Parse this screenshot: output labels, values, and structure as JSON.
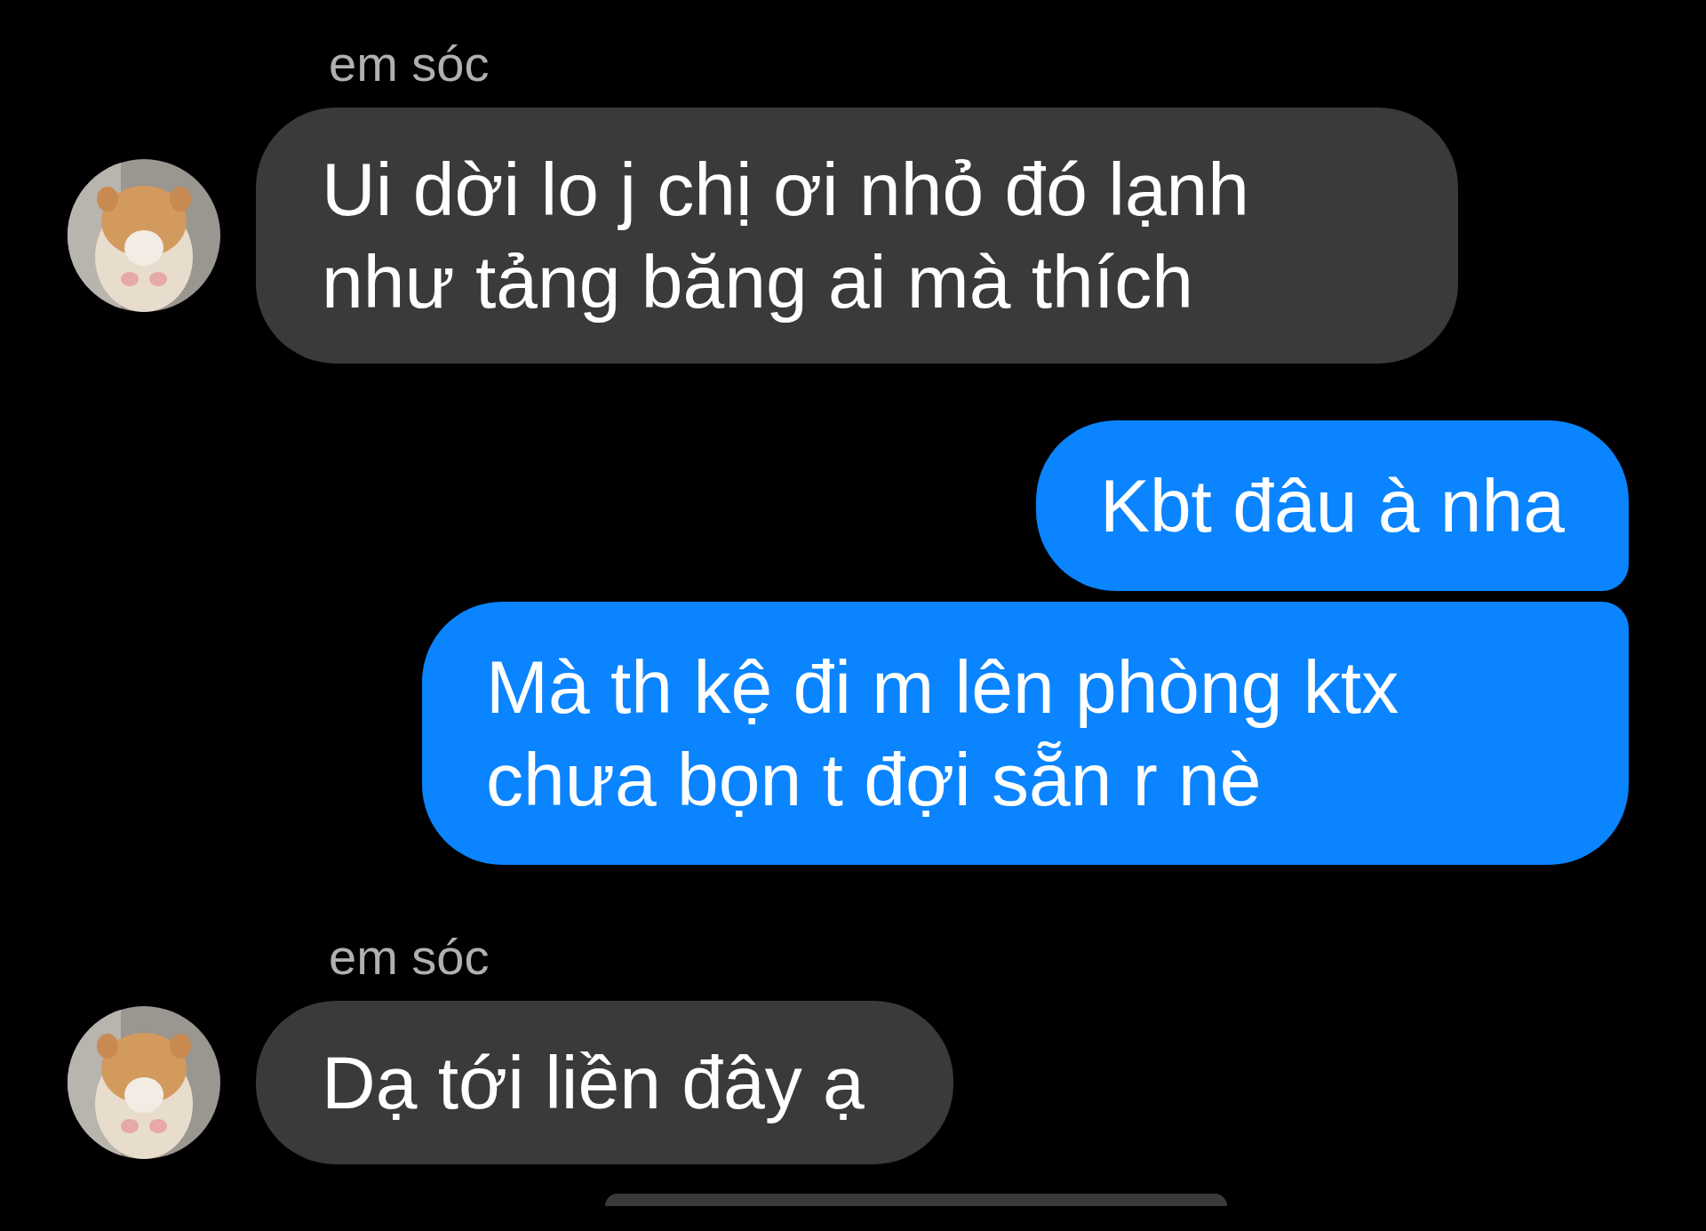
{
  "messages": [
    {
      "kind": "incoming",
      "sender": "em sóc",
      "text": "Ui dời lo j chị ơi nhỏ đó lạnh như tảng băng ai mà thích",
      "has_avatar": true
    },
    {
      "kind": "outgoing",
      "text": "Kbt đâu à nha"
    },
    {
      "kind": "outgoing",
      "text": "Mà th kệ đi m lên phòng ktx chưa bọn t đợi sẵn r nè"
    },
    {
      "kind": "incoming",
      "sender": "em sóc",
      "text": "Dạ tới liền đây ạ",
      "has_avatar": true
    },
    {
      "kind": "incoming_cut"
    }
  ]
}
